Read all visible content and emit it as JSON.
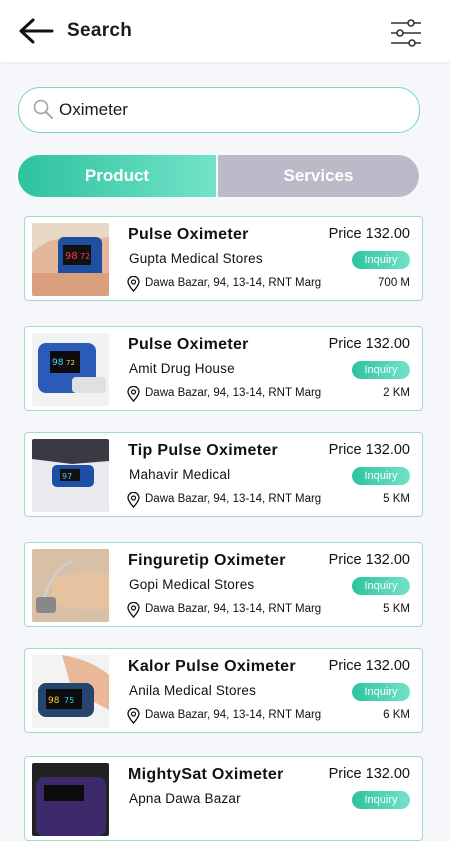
{
  "header": {
    "title": "Search"
  },
  "search": {
    "value": "Oximeter",
    "placeholder": "Search"
  },
  "tabs": [
    {
      "label": "Product",
      "active": true
    },
    {
      "label": "Services",
      "active": false
    }
  ],
  "price_label": "Price",
  "inquiry_label": "Inquiry",
  "products": [
    {
      "name": "Pulse Oximeter",
      "store": "Gupta Medical Stores",
      "address": "Dawa Bazar, 94, 13-14, RNT Marg",
      "price": "132.00",
      "distance": "700 M"
    },
    {
      "name": "Pulse Oximeter",
      "store": "Amit Drug House",
      "address": "Dawa Bazar, 94, 13-14, RNT Marg",
      "price": "132.00",
      "distance": "2 KM"
    },
    {
      "name": "Tip Pulse Oximeter",
      "store": "Mahavir Medical",
      "address": "Dawa Bazar, 94, 13-14, RNT Marg",
      "price": "132.00",
      "distance": "5 KM"
    },
    {
      "name": "Finguretip Oximeter",
      "store": "Gopi Medical Stores",
      "address": "Dawa Bazar, 94, 13-14, RNT Marg",
      "price": "132.00",
      "distance": "5 KM"
    },
    {
      "name": "Kalor Pulse Oximeter",
      "store": "Anila Medical Stores",
      "address": "Dawa Bazar, 94, 13-14, RNT Marg",
      "price": "132.00",
      "distance": "6 KM"
    },
    {
      "name": "MightySat Oximeter",
      "store": "Apna Dawa Bazar",
      "address": "",
      "price": "132.00",
      "distance": ""
    }
  ],
  "colors": {
    "accent_start": "#2ec29f",
    "accent_end": "#72e3c9",
    "inactive_tab": "#babac9",
    "card_border": "#9fdccb"
  },
  "icons": {
    "back": "arrow-left-icon",
    "filter": "sliders-icon",
    "search": "magnifier-icon",
    "location": "map-pin-icon"
  }
}
